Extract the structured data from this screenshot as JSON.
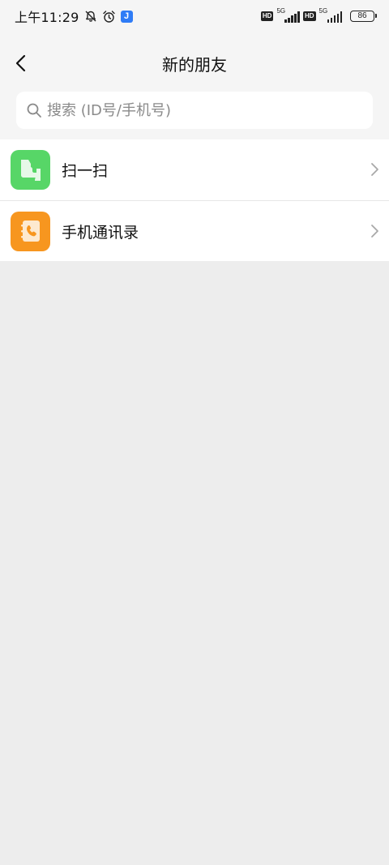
{
  "status_bar": {
    "time": "上午11:29",
    "icons": [
      "mute-bell-icon",
      "alarm-icon",
      "app-j-icon"
    ],
    "app_badge": "J",
    "hd1": "HD",
    "net1": "5G",
    "hd2": "HD",
    "net2": "5G",
    "battery": "86"
  },
  "nav": {
    "title": "新的朋友",
    "back_icon": "chevron-left-icon"
  },
  "search": {
    "placeholder": "搜索 (ID号/手机号)",
    "value": "",
    "icon": "search-icon"
  },
  "list": {
    "items": [
      {
        "label": "扫一扫",
        "icon": "scan-icon",
        "color": "#57d667"
      },
      {
        "label": "手机通讯录",
        "icon": "phone-contacts-icon",
        "color": "#f7961f"
      }
    ]
  },
  "colors": {
    "background": "#ededed",
    "header_background": "#f5f5f5",
    "card_background": "#ffffff"
  }
}
